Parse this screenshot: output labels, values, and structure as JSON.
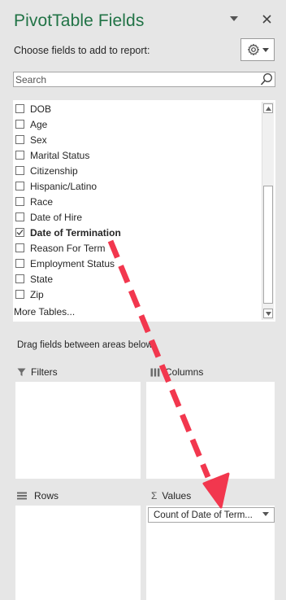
{
  "panel": {
    "title": "PivotTable Fields",
    "choose_label": "Choose fields to add to report:",
    "dropdown_icon": "caret-down-icon",
    "close_icon": "close-icon",
    "settings_icon": "gear-icon"
  },
  "search": {
    "placeholder": "Search",
    "value": "",
    "icon": "search-icon"
  },
  "fields": [
    {
      "label": "DOB",
      "checked": false
    },
    {
      "label": "Age",
      "checked": false
    },
    {
      "label": "Sex",
      "checked": false
    },
    {
      "label": "Marital Status",
      "checked": false
    },
    {
      "label": "Citizenship",
      "checked": false
    },
    {
      "label": "Hispanic/Latino",
      "checked": false
    },
    {
      "label": "Race",
      "checked": false
    },
    {
      "label": "Date of Hire",
      "checked": false
    },
    {
      "label": "Date of Termination",
      "checked": true
    },
    {
      "label": "Reason For Term",
      "checked": false
    },
    {
      "label": "Employment Status",
      "checked": false
    },
    {
      "label": "State",
      "checked": false
    },
    {
      "label": "Zip",
      "checked": false
    }
  ],
  "more_tables": "More Tables...",
  "drag_text": "Drag fields between areas below:",
  "areas": {
    "filters": "Filters",
    "columns": "Columns",
    "rows": "Rows",
    "values": "Values"
  },
  "values_items": [
    "Count of Date of Term..."
  ],
  "colors": {
    "accent": "#217346",
    "annotation_arrow": "#f2374e"
  }
}
